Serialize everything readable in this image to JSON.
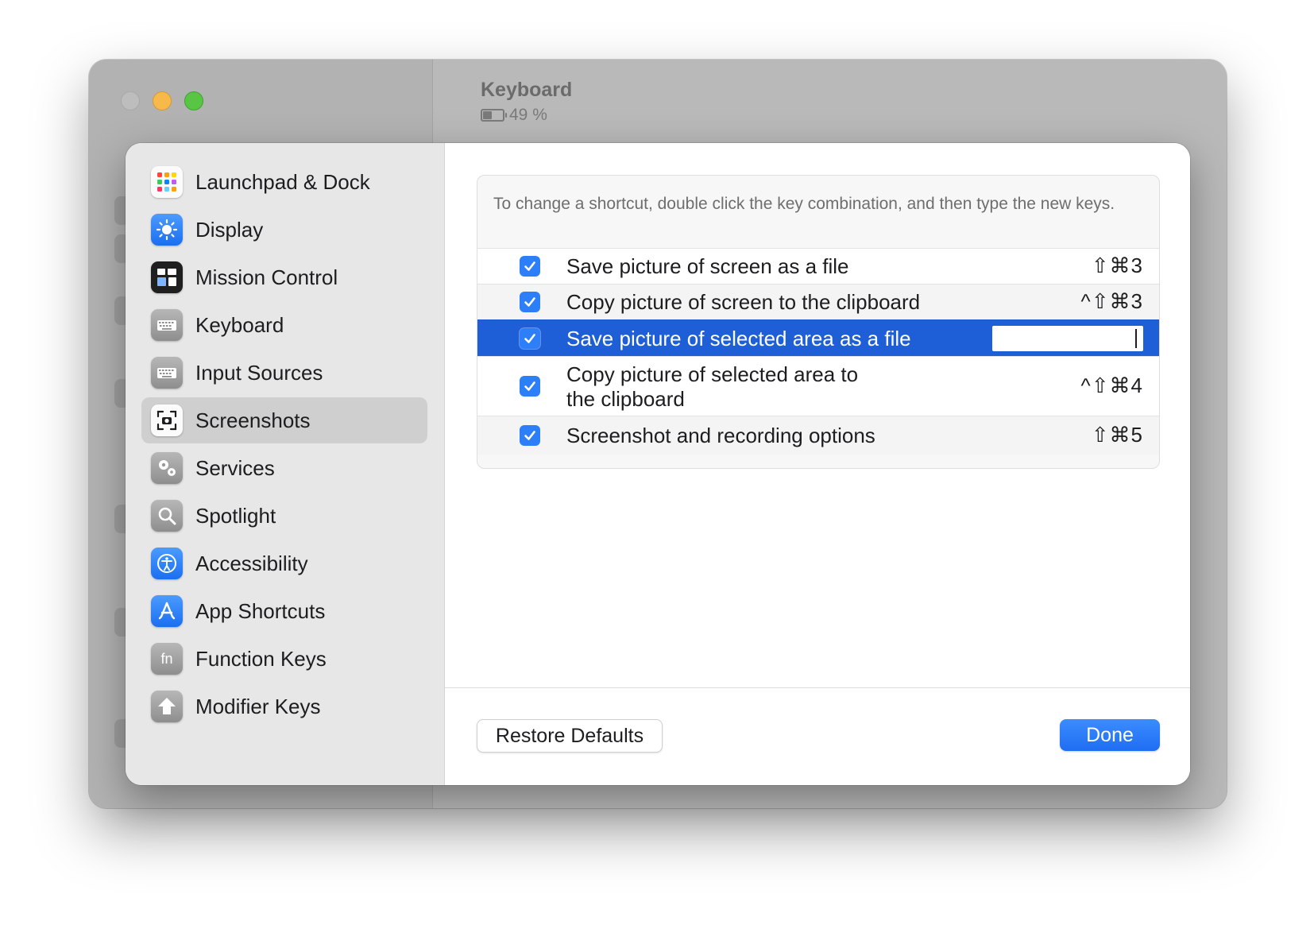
{
  "window": {
    "title": "Keyboard",
    "battery_text": "49 %",
    "battery_level_percent": 49
  },
  "sidebar": {
    "items": [
      {
        "label": "Launchpad & Dock",
        "icon": "launchpad-icon"
      },
      {
        "label": "Display",
        "icon": "display-brightness-icon"
      },
      {
        "label": "Mission Control",
        "icon": "mission-control-icon"
      },
      {
        "label": "Keyboard",
        "icon": "keyboard-icon"
      },
      {
        "label": "Input Sources",
        "icon": "keyboard-icon"
      },
      {
        "label": "Screenshots",
        "icon": "screenshot-icon",
        "selected": true
      },
      {
        "label": "Services",
        "icon": "gears-icon"
      },
      {
        "label": "Spotlight",
        "icon": "magnifier-icon"
      },
      {
        "label": "Accessibility",
        "icon": "accessibility-icon"
      },
      {
        "label": "App Shortcuts",
        "icon": "app-store-icon"
      },
      {
        "label": "Function Keys",
        "icon": "fn-icon"
      },
      {
        "label": "Modifier Keys",
        "icon": "arrow-up-icon"
      }
    ]
  },
  "main": {
    "help_text": "To change a shortcut, double click the key combination, and then type the new keys.",
    "shortcuts": [
      {
        "label": "Save picture of screen as a file",
        "keys": "⇧⌘3",
        "checked": true
      },
      {
        "label": "Copy picture of screen to the clipboard",
        "keys": "^⇧⌘3",
        "checked": true
      },
      {
        "label": "Save picture of selected area as a file",
        "keys": "",
        "checked": true,
        "selected": true,
        "editing": true
      },
      {
        "label": "Copy picture of selected area to",
        "label_line2": "the clipboard",
        "keys": "^⇧⌘4",
        "checked": true
      },
      {
        "label": "Screenshot and recording options",
        "keys": "⇧⌘5",
        "checked": true
      }
    ],
    "restore_label": "Restore Defaults",
    "done_label": "Done"
  },
  "colors": {
    "accent": "#1e5fd8",
    "checkbox": "#2d7ff9",
    "traffic_close": "#bdbdbd",
    "traffic_minimize": "#f6b94a",
    "traffic_maximize": "#58c544"
  }
}
